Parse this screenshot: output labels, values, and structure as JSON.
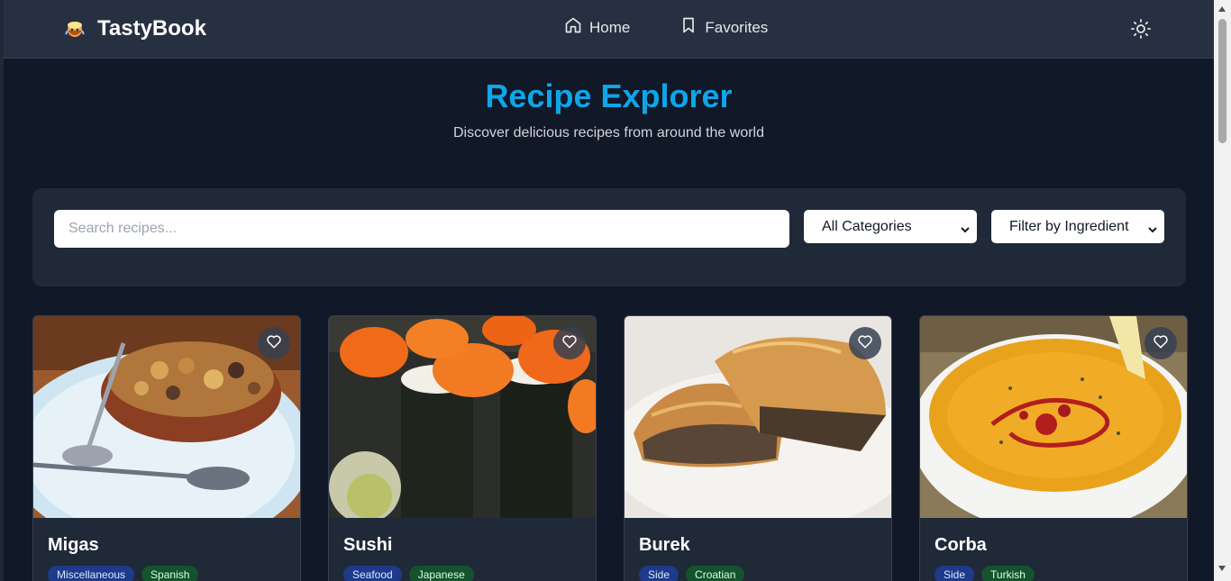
{
  "header": {
    "brand": "TastyBook",
    "nav": [
      {
        "label": "Home",
        "icon": "home-icon"
      },
      {
        "label": "Favorites",
        "icon": "bookmark-icon"
      }
    ],
    "theme_toggle_icon": "sun-icon"
  },
  "hero": {
    "title": "Recipe Explorer",
    "subtitle": "Discover delicious recipes from around the world"
  },
  "filters": {
    "search_placeholder": "Search recipes...",
    "search_value": "",
    "category_selected": "All Categories",
    "ingredient_selected": "Filter by Ingredient"
  },
  "recipes": [
    {
      "title": "Migas",
      "category": "Miscellaneous",
      "area": "Spanish"
    },
    {
      "title": "Sushi",
      "category": "Seafood",
      "area": "Japanese"
    },
    {
      "title": "Burek",
      "category": "Side",
      "area": "Croatian"
    },
    {
      "title": "Corba",
      "category": "Side",
      "area": "Turkish"
    }
  ],
  "colors": {
    "accent": "#0ea5e9",
    "background": "#111827",
    "navbar": "#273040",
    "panel": "#1f2937",
    "category_tag": "#1e3a8a",
    "area_tag": "#14532d"
  }
}
